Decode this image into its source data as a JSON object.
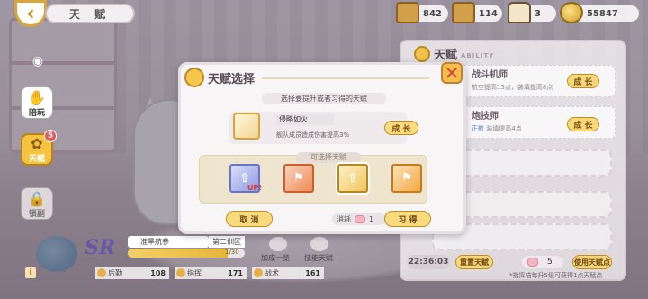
{
  "header": {
    "back_icon": "chevron-left-icon",
    "title": "天 赋"
  },
  "resources": [
    {
      "icon": "treasure-chest-icon",
      "value": "842"
    },
    {
      "icon": "wooden-crate-icon",
      "value": "114"
    },
    {
      "icon": "cake-box-icon",
      "value": "3"
    },
    {
      "icon": "gold-coin-icon",
      "value": "55847"
    }
  ],
  "sidebar": {
    "eye_icon": "eye-icon",
    "play_label": "陪玩",
    "talent_label": "天赋",
    "talent_badge": "5",
    "locked_label": "锁副"
  },
  "ability_panel": {
    "title": "天赋",
    "subtitle": "ABILITY",
    "rows": [
      {
        "name": "战斗机师",
        "desc": "航空提高15点，装填提高8点",
        "btn": "成 长"
      },
      {
        "name": "炮技师",
        "desc_prefix": "正航",
        "desc": "装填提高4点",
        "btn": "成 长"
      }
    ],
    "timer": "22:36:03",
    "reset_btn": "重置天赋",
    "cost_value": "5",
    "use_btn": "使用天赋点",
    "footnote": "*指挥喵每升5级可获得1点天赋点"
  },
  "bottom": {
    "rarity": "SR",
    "rank": "准旱航参",
    "rank_right": "第二训区",
    "xp_text": "1/30",
    "xp_fraction": 0.85,
    "action1": "加成一览",
    "action2": "技能天赋",
    "stats": [
      {
        "label": "后勤",
        "value": "108"
      },
      {
        "label": "指挥",
        "value": "171"
      },
      {
        "label": "战术",
        "value": "161"
      }
    ]
  },
  "modal": {
    "title": "天赋选择",
    "caption": "选择要提升或者习得的天赋",
    "selected_name": "侵略如火",
    "selected_desc": "舰队成员造成伤害提高3%",
    "grow_btn": "成 长",
    "available_header": "可选择天赋",
    "up_tag": "UP!",
    "cancel_btn": "取 消",
    "cost_label": "消耗",
    "cost_value": "1",
    "learn_btn": "习 得"
  },
  "colors": {
    "accent_gold": "#f7db7e",
    "close_red": "#d6463a",
    "rarity_purple": "#6757a6"
  }
}
